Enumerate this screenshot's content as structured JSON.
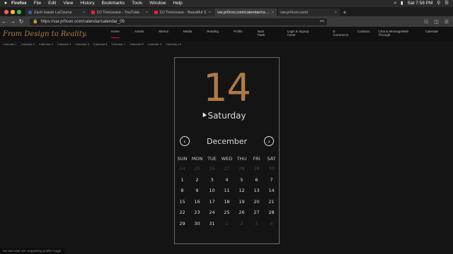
{
  "menubar": {
    "app": "Firefox",
    "items": [
      "File",
      "Edit",
      "View",
      "History",
      "Bookmarks",
      "Tools",
      "Window",
      "Help"
    ],
    "clock": "Sat 7:58 PM"
  },
  "tabs": [
    {
      "label": "Zach Isaiah LaCourse",
      "favcolor": "#3b5998"
    },
    {
      "label": "DJ Trenceave - YouTube",
      "favcolor": "#e22"
    },
    {
      "label": "DJ Trenceave - Beautiful S",
      "favcolor": "#e22"
    },
    {
      "label": "var.pr0con.com/calendar/calend",
      "favcolor": "#888"
    },
    {
      "label": "var.pr0con.com/",
      "favcolor": "#888"
    }
  ],
  "url": "https://var.pr0con.com/calendar/calendar_09",
  "site": {
    "logo": "From Design to Reality.",
    "nav": [
      "Home",
      "Assets",
      "Menus",
      "Media",
      "Reading",
      "Profile",
      "Num Pads",
      "Login & Signup Cover",
      "E-Commerce",
      "Contacts",
      "Chat & MessageWeb Through",
      "Calendar"
    ],
    "subnav": [
      "Calendar 1",
      "Calendar 2",
      "Calendar 3",
      "Calendar 4",
      "Calendar 5",
      "Calendar 6",
      "Calendar 7",
      "Calendar 8",
      "Calendar 9",
      "Calendar 10"
    ]
  },
  "calendar": {
    "day_number": "14",
    "day_name": "Saturday",
    "month": "December",
    "prev_icon": "‹",
    "next_icon": "›",
    "weekdays": [
      "SUN",
      "MON",
      "TUE",
      "WED",
      "THU",
      "FRI",
      "SAT"
    ],
    "days": [
      {
        "n": "24",
        "muted": true
      },
      {
        "n": "25",
        "muted": true
      },
      {
        "n": "26",
        "muted": true
      },
      {
        "n": "27",
        "muted": true
      },
      {
        "n": "28",
        "muted": true
      },
      {
        "n": "29",
        "muted": true
      },
      {
        "n": "30",
        "muted": true
      },
      {
        "n": "1"
      },
      {
        "n": "2"
      },
      {
        "n": "3"
      },
      {
        "n": "4"
      },
      {
        "n": "5"
      },
      {
        "n": "6"
      },
      {
        "n": "7"
      },
      {
        "n": "8"
      },
      {
        "n": "9"
      },
      {
        "n": "10"
      },
      {
        "n": "11"
      },
      {
        "n": "12"
      },
      {
        "n": "13"
      },
      {
        "n": "14"
      },
      {
        "n": "15"
      },
      {
        "n": "16"
      },
      {
        "n": "17"
      },
      {
        "n": "18"
      },
      {
        "n": "19"
      },
      {
        "n": "20"
      },
      {
        "n": "21"
      },
      {
        "n": "22"
      },
      {
        "n": "23"
      },
      {
        "n": "24"
      },
      {
        "n": "25"
      },
      {
        "n": "26"
      },
      {
        "n": "27"
      },
      {
        "n": "28"
      },
      {
        "n": "29"
      },
      {
        "n": "30"
      },
      {
        "n": "31"
      },
      {
        "n": "1",
        "muted": true
      },
      {
        "n": "2",
        "muted": true
      },
      {
        "n": "3",
        "muted": true
      },
      {
        "n": "4",
        "muted": true
      }
    ]
  },
  "status": "set and user set, requesting profile image"
}
